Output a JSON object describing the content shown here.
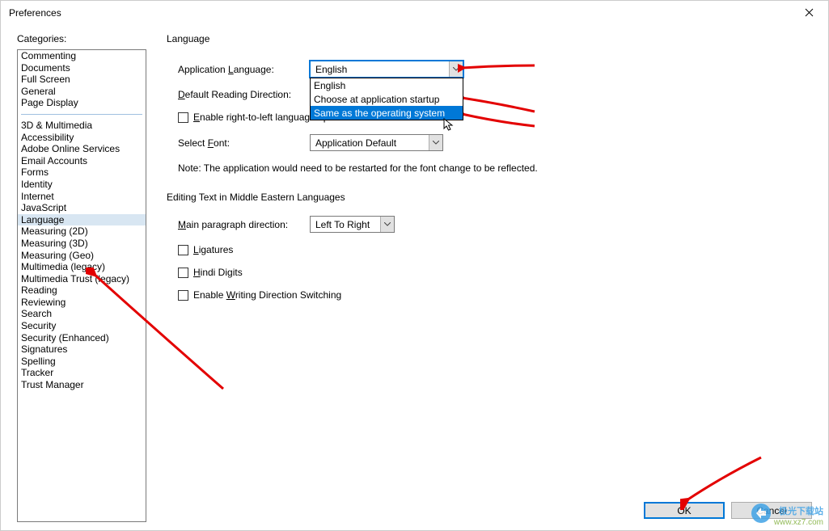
{
  "title": "Preferences",
  "categories_label": "Categories:",
  "categories_top": [
    "Commenting",
    "Documents",
    "Full Screen",
    "General",
    "Page Display"
  ],
  "categories_bottom": [
    "3D & Multimedia",
    "Accessibility",
    "Adobe Online Services",
    "Email Accounts",
    "Forms",
    "Identity",
    "Internet",
    "JavaScript",
    "Language",
    "Measuring (2D)",
    "Measuring (3D)",
    "Measuring (Geo)",
    "Multimedia (legacy)",
    "Multimedia Trust (legacy)",
    "Reading",
    "Reviewing",
    "Search",
    "Security",
    "Security (Enhanced)",
    "Signatures",
    "Spelling",
    "Tracker",
    "Trust Manager"
  ],
  "selected_category": "Language",
  "language": {
    "section": "Language",
    "app_lang_label_pre": "Application ",
    "app_lang_label_u": "L",
    "app_lang_label_post": "anguage:",
    "app_lang_value": "English",
    "app_lang_options": [
      "English",
      "Choose at application startup",
      "Same as the operating system"
    ],
    "highlighted_option_index": 2,
    "reading_label_u": "D",
    "reading_label_post": "efault Reading Direction:",
    "rtl_checkbox_u": "E",
    "rtl_checkbox_post": "nable right-to-left language options",
    "font_label_pre": "Select ",
    "font_label_u": "F",
    "font_label_post": "ont:",
    "font_value": "Application Default",
    "note": "Note: The application would need to be restarted for the font change to be reflected."
  },
  "editing": {
    "section": "Editing Text in Middle Eastern Languages",
    "main_para_u": "M",
    "main_para_post": "ain paragraph direction:",
    "main_para_value": "Left To Right",
    "ligatures_u": "L",
    "ligatures_post": "igatures",
    "hindi_u": "H",
    "hindi_post": "indi Digits",
    "switching_pre": "Enable ",
    "switching_u": "W",
    "switching_post": "riting Direction Switching"
  },
  "buttons": {
    "ok": "OK",
    "cancel": "Cancel"
  },
  "watermark": {
    "line1": "极光下载站",
    "line2": "www.xz7.com"
  }
}
